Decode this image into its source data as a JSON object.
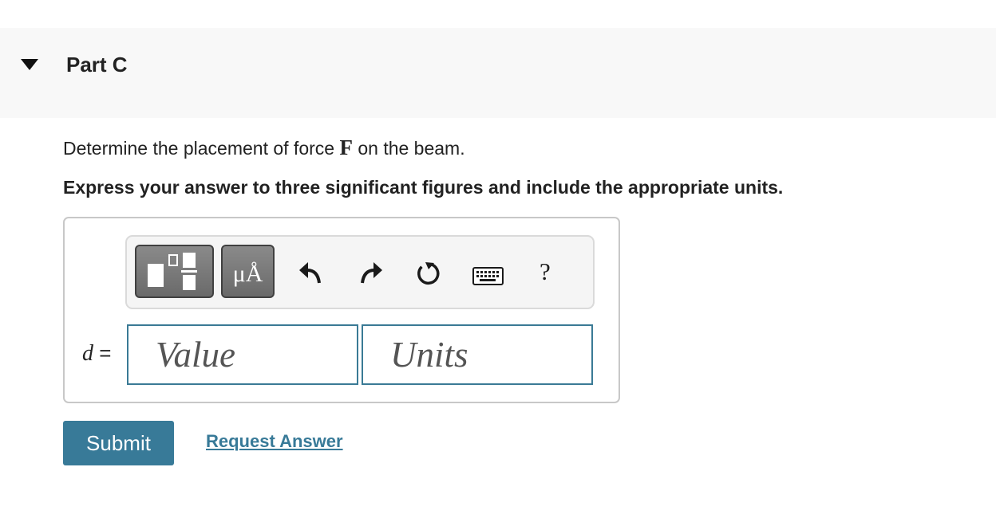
{
  "part": {
    "title": "Part C"
  },
  "question": {
    "text_before": "Determine the placement of force ",
    "symbol": "F",
    "text_after": " on the beam."
  },
  "instruction": "Express your answer to three significant figures and include the appropriate units.",
  "toolbar": {
    "units_button_label": "μÅ",
    "help_label": "?",
    "icons": [
      "fraction-template-icon",
      "undo-icon",
      "redo-icon",
      "reset-icon",
      "keyboard-icon",
      "help-icon"
    ]
  },
  "answer": {
    "variable": "d",
    "equals": "=",
    "value_placeholder": "Value",
    "units_placeholder": "Units"
  },
  "actions": {
    "submit_label": "Submit",
    "request_label": "Request Answer"
  },
  "colors": {
    "accent": "#387a98",
    "field_border": "#3a7a95",
    "header_bg": "#f8f8f8"
  }
}
